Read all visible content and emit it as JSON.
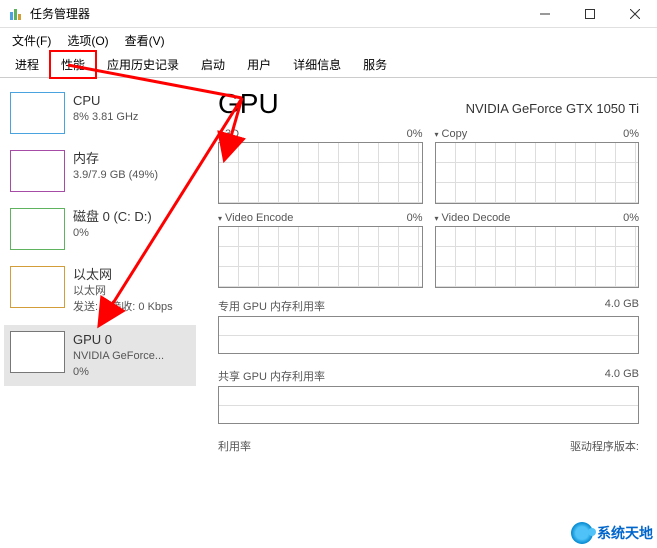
{
  "titlebar": {
    "title": "任务管理器"
  },
  "menubar": {
    "file": "文件(F)",
    "options": "选项(O)",
    "view": "查看(V)"
  },
  "tabs": {
    "processes": "进程",
    "performance": "性能",
    "app_history": "应用历史记录",
    "startup": "启动",
    "users": "用户",
    "details": "详细信息",
    "services": "服务"
  },
  "sidebar": {
    "cpu": {
      "title": "CPU",
      "sub": "8% 3.81 GHz"
    },
    "mem": {
      "title": "内存",
      "sub": "3.9/7.9 GB (49%)"
    },
    "disk": {
      "title": "磁盘 0 (C: D:)",
      "sub": "0%"
    },
    "eth": {
      "title": "以太网",
      "sub1": "以太网",
      "sub2": "发送: 0 接收: 0 Kbps"
    },
    "gpu": {
      "title": "GPU 0",
      "sub1": "NVIDIA GeForce...",
      "sub2": "0%"
    }
  },
  "main": {
    "title": "GPU",
    "device": "NVIDIA GeForce GTX 1050 Ti",
    "charts": {
      "c3d": {
        "label": "3D",
        "pct": "0%"
      },
      "copy": {
        "label": "Copy",
        "pct": "0%"
      },
      "venc": {
        "label": "Video Encode",
        "pct": "0%"
      },
      "vdec": {
        "label": "Video Decode",
        "pct": "0%"
      }
    },
    "dedicated": {
      "label": "专用 GPU 内存利用率",
      "val": "4.0 GB"
    },
    "shared": {
      "label": "共享 GPU 内存利用率",
      "val": "4.0 GB"
    },
    "footer": {
      "left": "利用率",
      "right": "驱动程序版本:"
    }
  },
  "watermark": {
    "text": "系统天地"
  }
}
